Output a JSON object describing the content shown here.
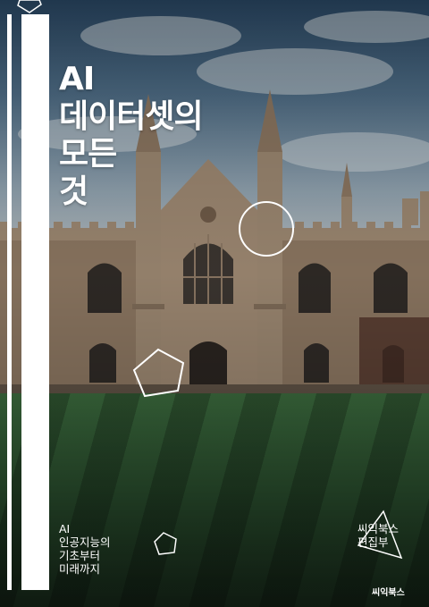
{
  "cover": {
    "title_lines": [
      "AI",
      "데이터셋의",
      "모든",
      "것"
    ],
    "subtitle_lines": [
      "AI",
      "인공지능의",
      "기초부터",
      "미래까지"
    ],
    "author_lines": [
      "씨익북스",
      "편집부"
    ],
    "publisher_logo": "씨익북스"
  },
  "decorations": [
    "circle-outline",
    "pentagon-outline",
    "small-pentagon-outline",
    "triangle-outline",
    "top-pentagon-outline"
  ]
}
